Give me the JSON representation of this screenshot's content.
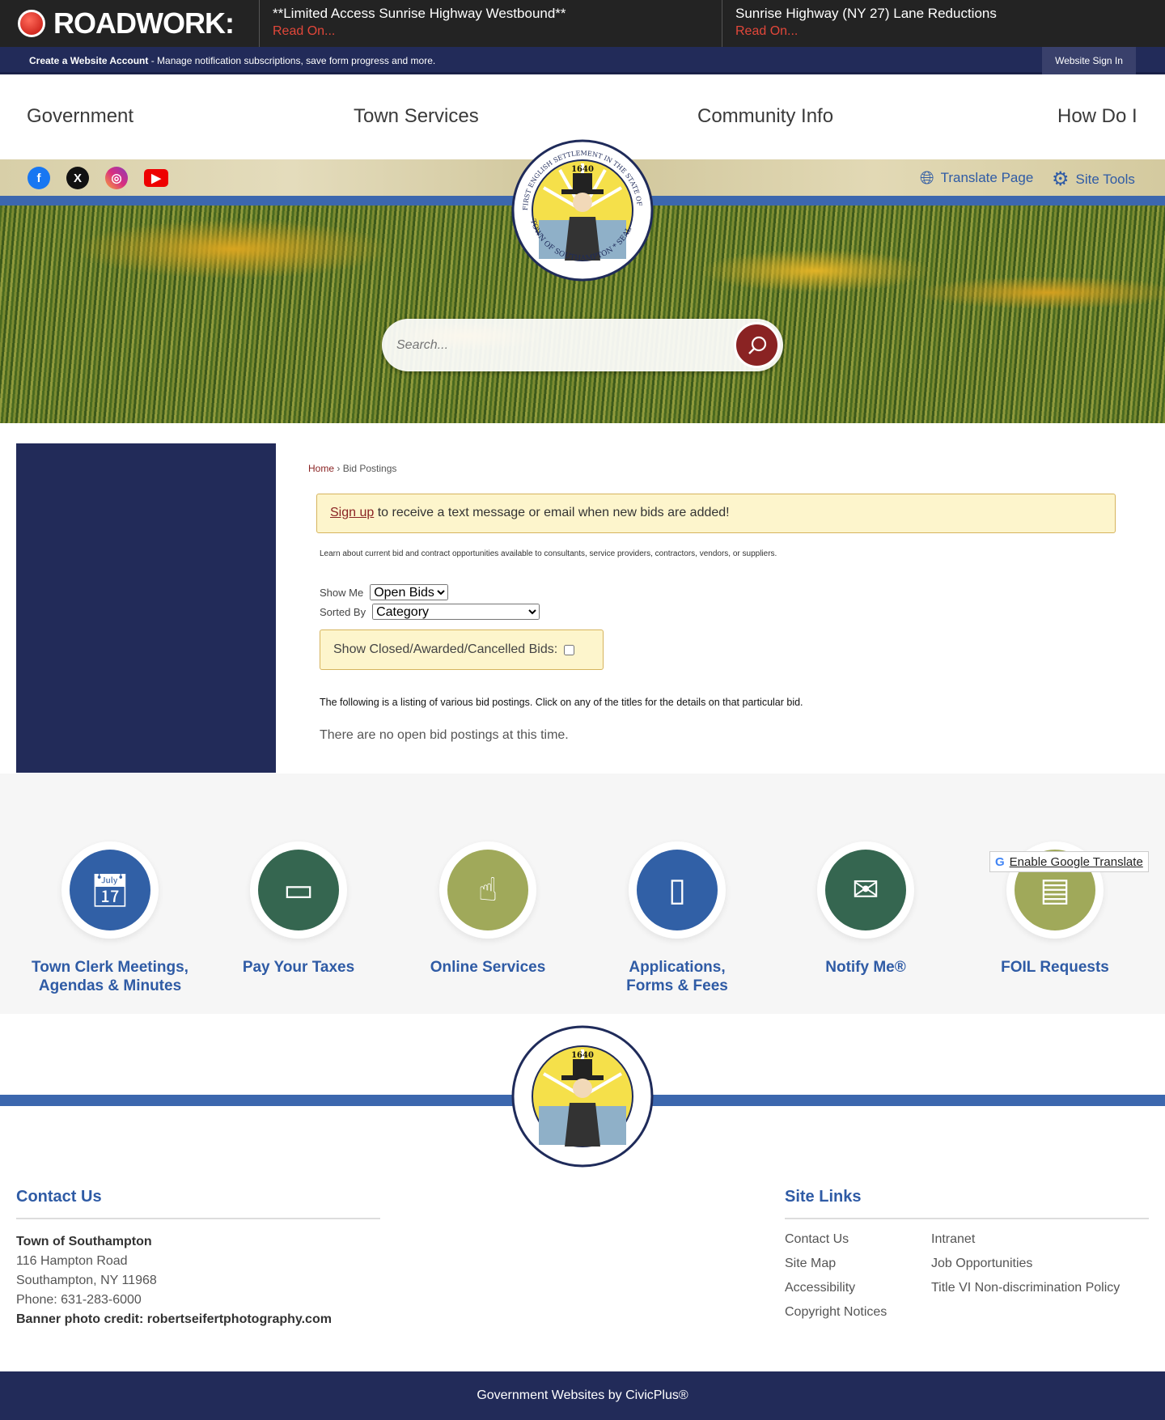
{
  "alert": {
    "title": "ROADWORK:",
    "items": [
      {
        "title": "**Limited Access Sunrise Highway Westbound**",
        "link": "Read On..."
      },
      {
        "title": "Sunrise Highway (NY 27) Lane Reductions",
        "link": "Read On..."
      }
    ]
  },
  "account": {
    "create": "Create a Website Account",
    "desc": " - Manage notification subscriptions, save form progress and more.",
    "signin": "Website Sign In"
  },
  "nav": [
    "Government",
    "Town Services",
    "Community Info",
    "How Do I"
  ],
  "social": [
    "facebook-icon",
    "x-icon",
    "instagram-icon",
    "youtube-icon"
  ],
  "tools": {
    "translate": "Translate Page",
    "site_tools": "Site Tools"
  },
  "seal": {
    "year": "1640",
    "ring_text": "FIRST ENGLISH SETTLEMENT IN THE STATE OF N.Y.",
    "bottom_text": "TOWN OF SOUTHAMPTON * SEAL"
  },
  "search": {
    "placeholder": "Search..."
  },
  "breadcrumb": {
    "home": "Home",
    "sep": " › ",
    "current": "Bid Postings"
  },
  "notice": {
    "link": "Sign up",
    "text": " to receive a text message or email when new bids are added!"
  },
  "learn": "Learn about current bid and contract opportunities available to consultants, service providers, contractors, vendors, or suppliers.",
  "filters": {
    "show_me_label": "Show Me",
    "show_me_value": "Open Bids",
    "sorted_label": "Sorted By",
    "sorted_value": "Category",
    "closed_label": "Show Closed/Awarded/Cancelled Bids:"
  },
  "listing_text": "The following is a listing of various bid postings. Click on any of the titles for the details on that particular bid.",
  "no_bids": "There are no open bid postings at this time.",
  "quick_links": [
    {
      "line1": "Town Clerk Meetings,",
      "line2": "Agendas & Minutes",
      "color": "#3160a6",
      "icon": "calendar-clock-icon"
    },
    {
      "line1": "Pay Your Taxes",
      "line2": "",
      "color": "#356650",
      "icon": "credit-card-icon"
    },
    {
      "line1": "Online Services",
      "line2": "",
      "color": "#a0a95a",
      "icon": "touch-icon"
    },
    {
      "line1": "Applications,",
      "line2": "Forms & Fees",
      "color": "#3160a6",
      "icon": "forms-icon"
    },
    {
      "line1": "Notify Me®",
      "line2": "",
      "color": "#356650",
      "icon": "envelope-icon"
    },
    {
      "line1": "FOIL Requests",
      "line2": "",
      "color": "#a0a95a",
      "icon": "document-icon"
    }
  ],
  "google_translate": "Enable Google Translate",
  "footer": {
    "contact_heading": "Contact Us",
    "contact": {
      "name": "Town of Southampton",
      "street": "116 Hampton Road",
      "city": "Southampton, NY 11968",
      "phone": "Phone: 631-283-6000",
      "credit": "Banner photo credit: robertseifertphotography.com"
    },
    "links_heading": "Site Links",
    "links_col1": [
      "Contact Us",
      "Site Map",
      "Accessibility",
      "Copyright Notices"
    ],
    "links_col2": [
      "Intranet",
      "Job Opportunities",
      "Title VI Non-discrimination Policy"
    ],
    "bottom": "Government Websites by CivicPlus®"
  }
}
